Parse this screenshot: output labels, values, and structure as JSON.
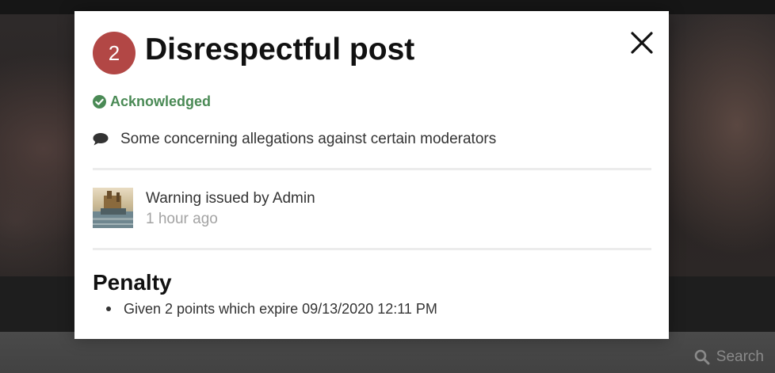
{
  "background": {
    "search_label": "Search"
  },
  "modal": {
    "points": "2",
    "title": "Disrespectful post",
    "status": "Acknowledged",
    "reason": "Some concerning allegations against certain moderators",
    "issuer": "Warning issued by Admin",
    "issued_time": "1 hour ago",
    "penalty_heading": "Penalty",
    "penalty_items": [
      "Given 2 points which expire 09/13/2020 12:11 PM"
    ]
  },
  "colors": {
    "badge": "#b24745",
    "status_green": "#4a8a55",
    "footer_bar": "#4a4a4a"
  },
  "icons": {
    "close": "close-icon",
    "status": "check-circle-icon",
    "reason": "comment-icon",
    "search": "search-icon"
  }
}
